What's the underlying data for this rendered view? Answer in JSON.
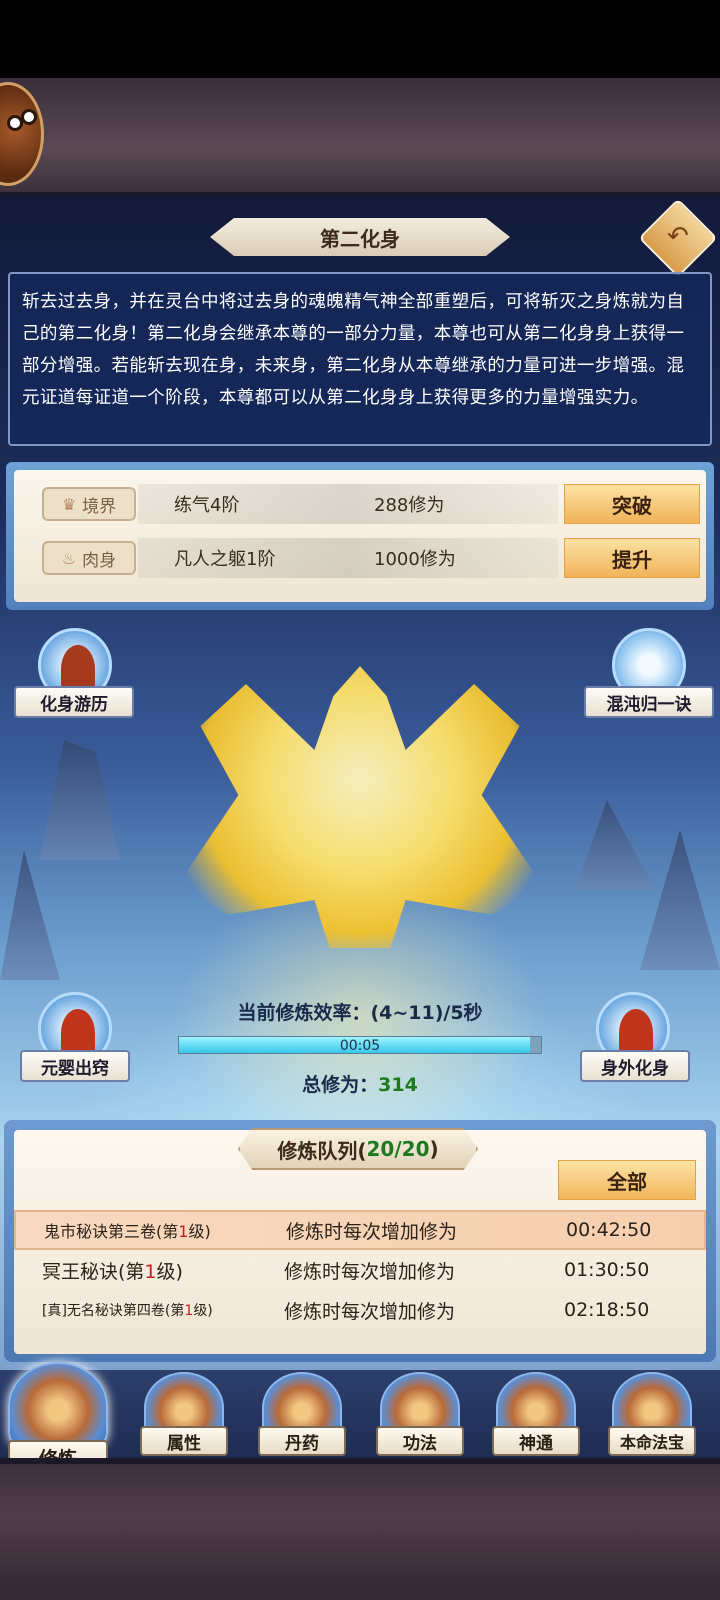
{
  "title": "第二化身",
  "description": "斩去过去身，并在灵台中将过去身的魂魄精气神全部重塑后，可将斩灭之身炼就为自己的第二化身！第二化身会继承本尊的一部分力量，本尊也可从第二化身身上获得一部分增强。若能斩去现在身，未来身，第二化身从本尊继承的力量可进一步增强。混元证道每证道一个阶段，本尊都可以从第二化身身上获得更多的力量增强实力。",
  "stats": [
    {
      "label": "境界",
      "icon": "crown-icon",
      "name": "练气4阶",
      "value": "288修为",
      "button": "突破"
    },
    {
      "label": "肉身",
      "icon": "flame-icon",
      "name": "凡人之躯1阶",
      "value": "1000修为",
      "button": "提升"
    }
  ],
  "side_buttons": {
    "travel": "化身游历",
    "chaos": "混沌归一诀",
    "yuanying": "元婴出窍",
    "avatar": "身外化身"
  },
  "cultivation": {
    "rate_label": "当前修炼效率：(4~11)/5秒",
    "timer": "00:05",
    "progress": 0.97,
    "total_label": "总修为：",
    "total_value": "314"
  },
  "queue": {
    "title": "修炼队列(",
    "count": "20/20",
    "title_end": " )",
    "all_button": "全部",
    "rows": [
      {
        "name_a": "鬼市秘诀第三卷(第",
        "level": "1",
        "name_b": "级)",
        "desc": "修炼时每次增加修为",
        "time": "00:42:50",
        "size": 16
      },
      {
        "name_a": "冥王秘诀(第",
        "level": "1",
        "name_b": "级)",
        "desc": "修炼时每次增加修为",
        "time": "01:30:50",
        "size": 19
      },
      {
        "name_a": "[真]无名秘诀第四卷(第",
        "level": "1",
        "name_b": "级)",
        "desc": "修炼时每次增加修为",
        "time": "02:18:50",
        "size": 14
      }
    ]
  },
  "nav": [
    "修炼",
    "属性",
    "丹药",
    "功法",
    "神通",
    "本命法宝"
  ],
  "colors": {
    "accent_gold": "#f1b35a",
    "count_green": "#1e7a22",
    "level_red": "#c81e1e"
  }
}
